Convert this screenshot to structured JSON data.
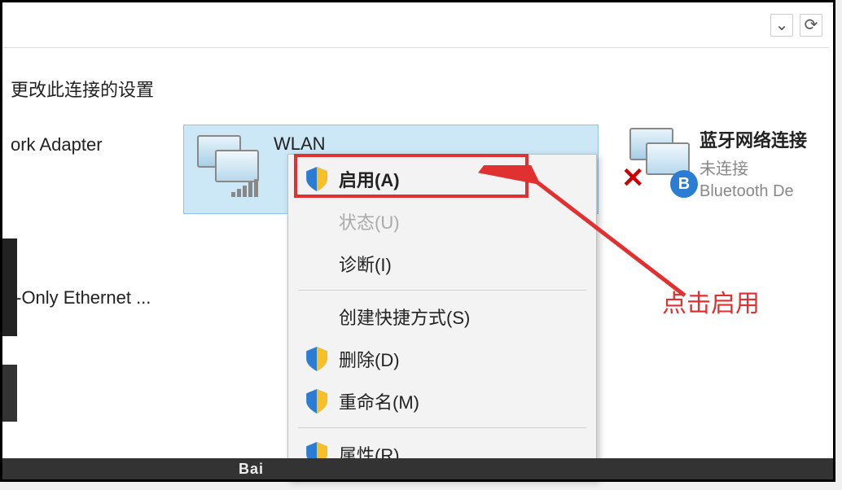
{
  "toolbar": {
    "dropdown_icon": "⌄",
    "refresh_icon": "⟳"
  },
  "subtitle": "更改此连接的设置",
  "adapters": {
    "left": {
      "name": "ork Adapter"
    },
    "wlan": {
      "name": "WLAN"
    },
    "host": {
      "name": "t-Only Ethernet ..."
    },
    "bluetooth": {
      "name": "蓝牙网络连接",
      "status": "未连接",
      "device": "Bluetooth De"
    }
  },
  "context_menu": {
    "enable": "启用(A)",
    "status": "状态(U)",
    "diagnose": "诊断(I)",
    "shortcut": "创建快捷方式(S)",
    "delete": "删除(D)",
    "rename": "重命名(M)",
    "properties": "属性(R)"
  },
  "annotation": "点击启用",
  "taskbar_text": "Bai",
  "x_mark": "✕",
  "bt_glyph": "B"
}
